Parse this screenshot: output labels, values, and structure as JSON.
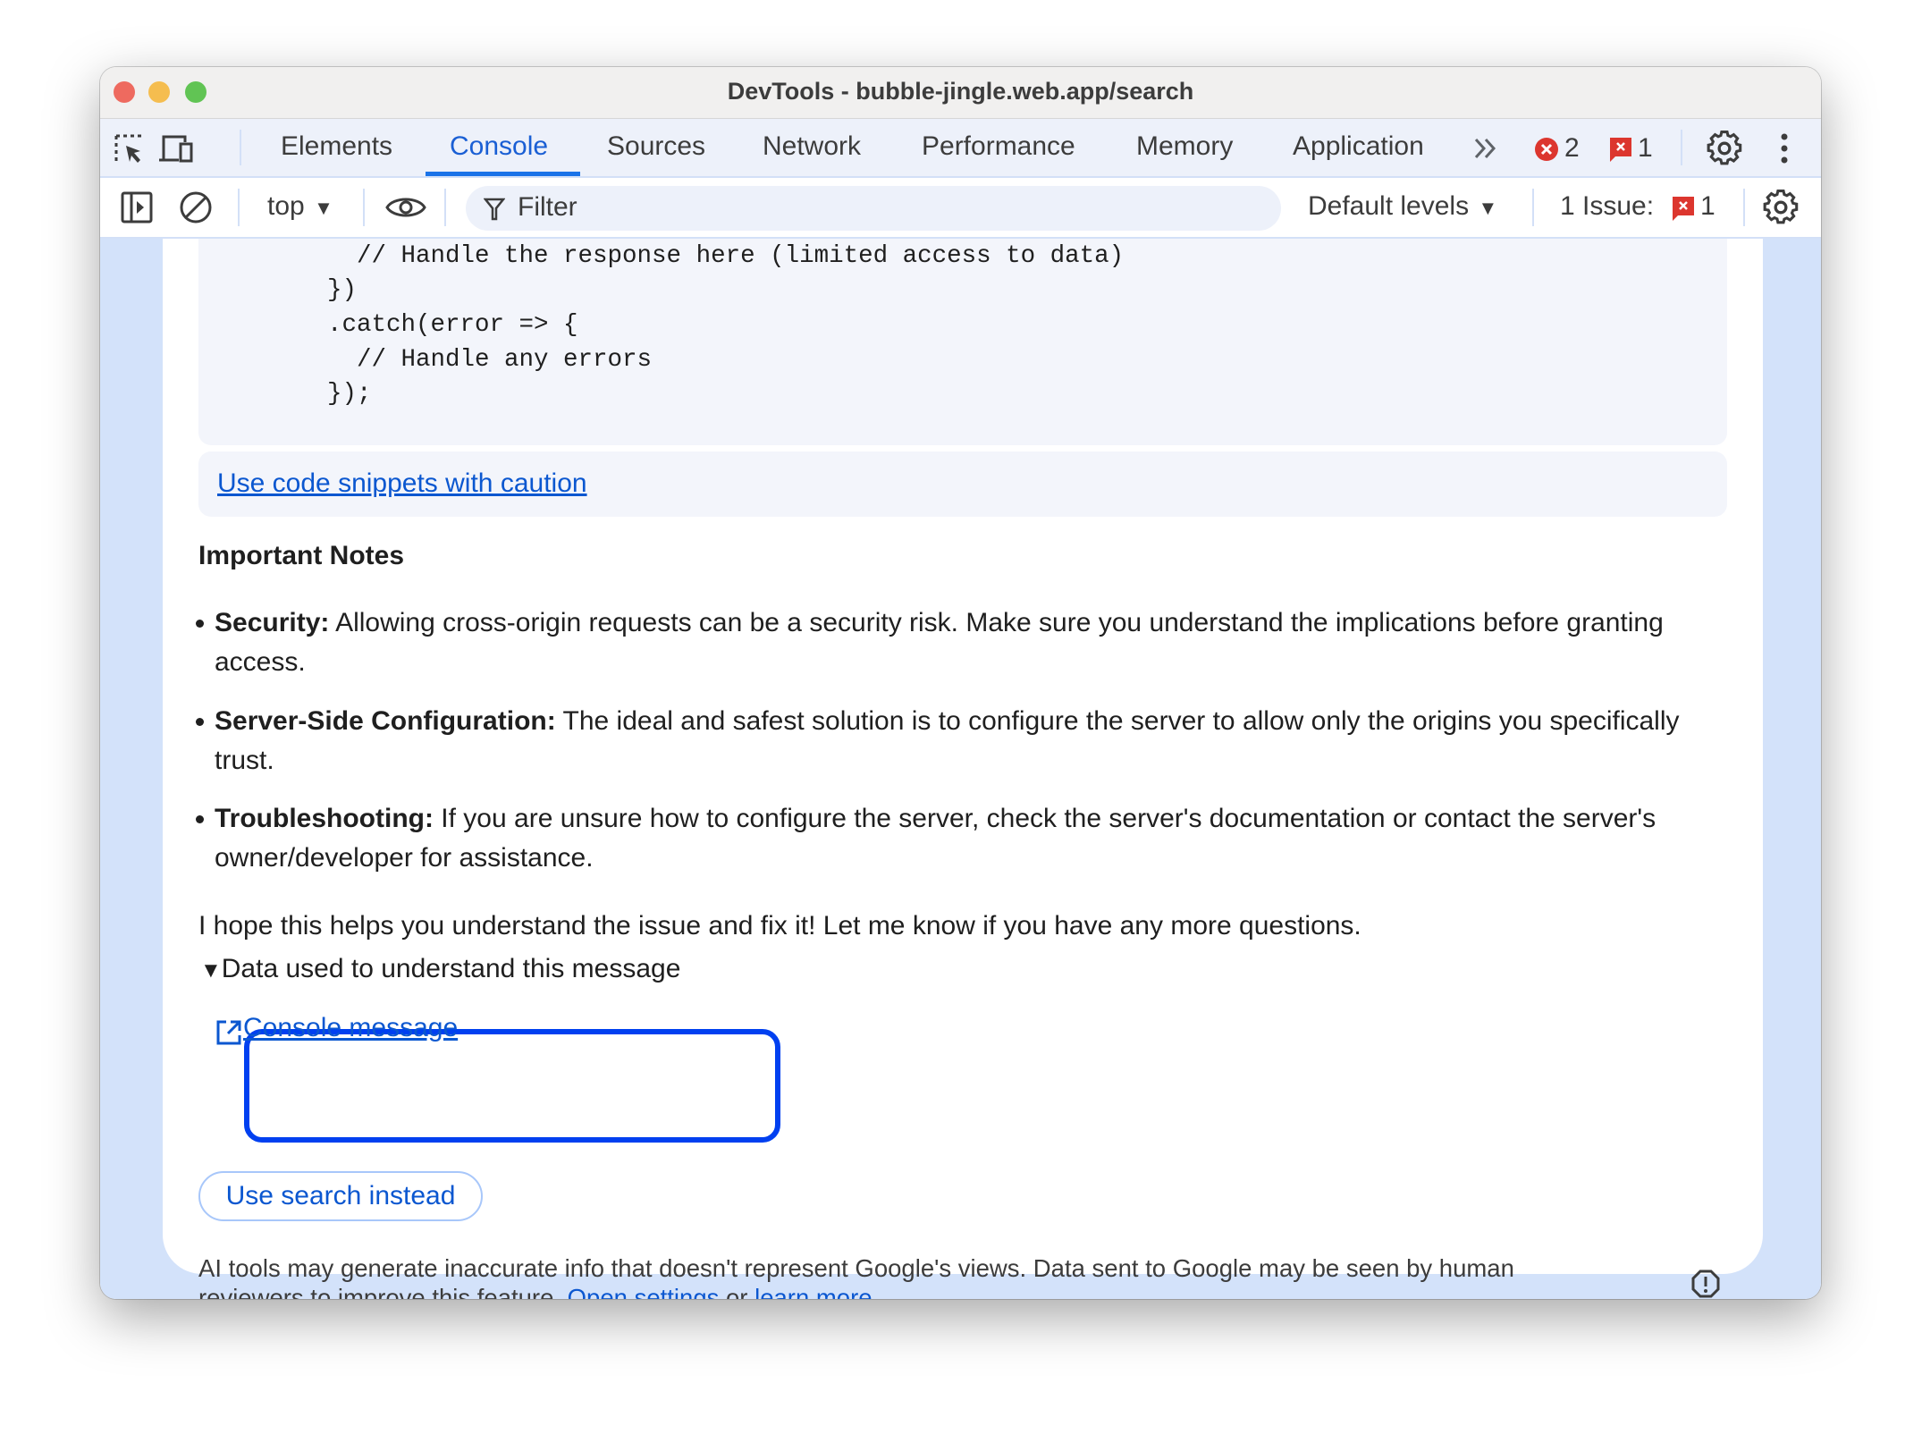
{
  "window": {
    "title": "DevTools - bubble-jingle.web.app/search",
    "traffic_lights": {
      "close": "#ee6a5f",
      "minimize": "#f5bd4f",
      "zoom": "#61c454"
    }
  },
  "tabs": [
    {
      "label": "Elements",
      "active": false
    },
    {
      "label": "Console",
      "active": true
    },
    {
      "label": "Sources",
      "active": false
    },
    {
      "label": "Network",
      "active": false
    },
    {
      "label": "Performance",
      "active": false
    },
    {
      "label": "Memory",
      "active": false
    },
    {
      "label": "Application",
      "active": false
    }
  ],
  "tabbar_right": {
    "more_tabs_icon": "chevron-double-right",
    "error_count": "2",
    "issue_count": "1",
    "error_color": "#dc362e"
  },
  "toolbar": {
    "context": "top",
    "filter_placeholder": "Filter",
    "levels": "Default levels",
    "issues_label": "1 Issue:",
    "issues_count": "1"
  },
  "code_lines": [
    "  // Handle the response here (limited access to data)",
    "})",
    ".catch(error => {",
    "  // Handle any errors",
    "});"
  ],
  "caution_link": "Use code snippets with caution",
  "notes_heading": "Important Notes",
  "notes": [
    {
      "term": "Security:",
      "text": " Allowing cross-origin requests can be a security risk. Make sure you understand the implications before granting access."
    },
    {
      "term": "Server-Side Configuration:",
      "text": " The ideal and safest solution is to configure the server to allow only the origins you specifically trust."
    },
    {
      "term": "Troubleshooting:",
      "text": " If you are unsure how to configure the server, check the server's documentation or contact the server's owner/developer for assistance."
    }
  ],
  "closing": "I hope this helps you understand the issue and fix it! Let me know if you have any more questions.",
  "data_used": {
    "summary": "Data used to understand this message",
    "link": "Console message"
  },
  "search_button": "Use search instead",
  "disclaimer": {
    "text": "AI tools may generate inaccurate info that doesn't represent Google's views. Data sent to Google may be seen by human reviewers to improve this feature. ",
    "settings_link": "Open settings",
    "or": " or ",
    "learn_link": "learn more"
  },
  "highlight_color": "#0040f0",
  "accent_color": "#0b57d0"
}
